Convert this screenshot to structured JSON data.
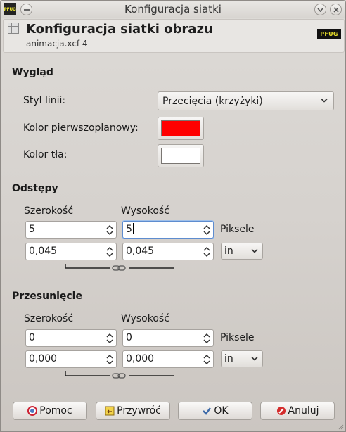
{
  "window": {
    "title": "Konfiguracja siatki"
  },
  "header": {
    "title": "Konfiguracja siatki obrazu",
    "subtitle": "animacja.xcf-4",
    "logo_text": "PFUG"
  },
  "appearance": {
    "section": "Wygląd",
    "line_style_label": "Styl linii:",
    "line_style_value": "Przecięcia (krzyżyki)",
    "fg_label": "Kolor pierwszoplanowy:",
    "fg_color": "#ff0000",
    "bg_label": "Kolor tła:",
    "bg_color": "#ffffff"
  },
  "spacing": {
    "section": "Odstępy",
    "width_label": "Szerokość",
    "height_label": "Wysokość",
    "px_width": "5",
    "px_height": "5",
    "px_unit": "Piksele",
    "unit_width": "0,045",
    "unit_height": "0,045",
    "unit": "in"
  },
  "offset": {
    "section": "Przesunięcie",
    "width_label": "Szerokość",
    "height_label": "Wysokość",
    "px_width": "0",
    "px_height": "0",
    "px_unit": "Piksele",
    "unit_width": "0,000",
    "unit_height": "0,000",
    "unit": "in"
  },
  "buttons": {
    "help": "Pomoc",
    "reset": "Przywróć",
    "ok": "OK",
    "cancel": "Anuluj"
  },
  "colors": {
    "accent": "#5e8ccf",
    "fg_swatch": "#ff0000",
    "bg_swatch": "#ffffff"
  }
}
